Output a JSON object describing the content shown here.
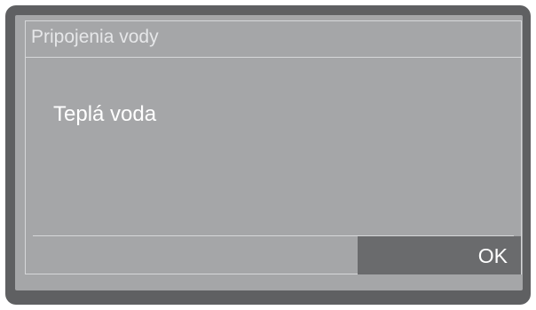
{
  "dialog": {
    "title": "Pripojenia vody",
    "content": "Teplá voda",
    "ok_label": "OK"
  },
  "colors": {
    "bezel": "#5f6062",
    "screen": "#a5a6a8",
    "button": "#6a6b6d",
    "text": "#ffffff"
  }
}
